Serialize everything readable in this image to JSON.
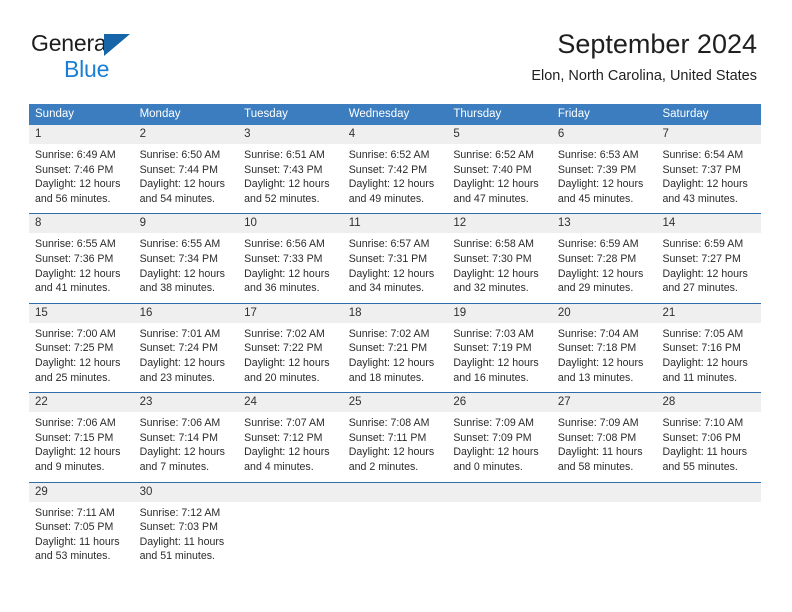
{
  "brand": {
    "line1": "General",
    "line2": "Blue",
    "triangle_color": "#1565a8",
    "blue_color": "#1a7fd4"
  },
  "header": {
    "title": "September 2024",
    "subtitle": "Elon, North Carolina, United States"
  },
  "theme": {
    "header_blue": "#3b7dbf",
    "row_divider_blue": "#2f6da8",
    "day_band_gray": "#efefef",
    "text": "#2b2b2b"
  },
  "weekdays": [
    "Sunday",
    "Monday",
    "Tuesday",
    "Wednesday",
    "Thursday",
    "Friday",
    "Saturday"
  ],
  "weeks": [
    [
      {
        "day": "1",
        "sunrise": "Sunrise: 6:49 AM",
        "sunset": "Sunset: 7:46 PM",
        "daylight1": "Daylight: 12 hours",
        "daylight2": "and 56 minutes."
      },
      {
        "day": "2",
        "sunrise": "Sunrise: 6:50 AM",
        "sunset": "Sunset: 7:44 PM",
        "daylight1": "Daylight: 12 hours",
        "daylight2": "and 54 minutes."
      },
      {
        "day": "3",
        "sunrise": "Sunrise: 6:51 AM",
        "sunset": "Sunset: 7:43 PM",
        "daylight1": "Daylight: 12 hours",
        "daylight2": "and 52 minutes."
      },
      {
        "day": "4",
        "sunrise": "Sunrise: 6:52 AM",
        "sunset": "Sunset: 7:42 PM",
        "daylight1": "Daylight: 12 hours",
        "daylight2": "and 49 minutes."
      },
      {
        "day": "5",
        "sunrise": "Sunrise: 6:52 AM",
        "sunset": "Sunset: 7:40 PM",
        "daylight1": "Daylight: 12 hours",
        "daylight2": "and 47 minutes."
      },
      {
        "day": "6",
        "sunrise": "Sunrise: 6:53 AM",
        "sunset": "Sunset: 7:39 PM",
        "daylight1": "Daylight: 12 hours",
        "daylight2": "and 45 minutes."
      },
      {
        "day": "7",
        "sunrise": "Sunrise: 6:54 AM",
        "sunset": "Sunset: 7:37 PM",
        "daylight1": "Daylight: 12 hours",
        "daylight2": "and 43 minutes."
      }
    ],
    [
      {
        "day": "8",
        "sunrise": "Sunrise: 6:55 AM",
        "sunset": "Sunset: 7:36 PM",
        "daylight1": "Daylight: 12 hours",
        "daylight2": "and 41 minutes."
      },
      {
        "day": "9",
        "sunrise": "Sunrise: 6:55 AM",
        "sunset": "Sunset: 7:34 PM",
        "daylight1": "Daylight: 12 hours",
        "daylight2": "and 38 minutes."
      },
      {
        "day": "10",
        "sunrise": "Sunrise: 6:56 AM",
        "sunset": "Sunset: 7:33 PM",
        "daylight1": "Daylight: 12 hours",
        "daylight2": "and 36 minutes."
      },
      {
        "day": "11",
        "sunrise": "Sunrise: 6:57 AM",
        "sunset": "Sunset: 7:31 PM",
        "daylight1": "Daylight: 12 hours",
        "daylight2": "and 34 minutes."
      },
      {
        "day": "12",
        "sunrise": "Sunrise: 6:58 AM",
        "sunset": "Sunset: 7:30 PM",
        "daylight1": "Daylight: 12 hours",
        "daylight2": "and 32 minutes."
      },
      {
        "day": "13",
        "sunrise": "Sunrise: 6:59 AM",
        "sunset": "Sunset: 7:28 PM",
        "daylight1": "Daylight: 12 hours",
        "daylight2": "and 29 minutes."
      },
      {
        "day": "14",
        "sunrise": "Sunrise: 6:59 AM",
        "sunset": "Sunset: 7:27 PM",
        "daylight1": "Daylight: 12 hours",
        "daylight2": "and 27 minutes."
      }
    ],
    [
      {
        "day": "15",
        "sunrise": "Sunrise: 7:00 AM",
        "sunset": "Sunset: 7:25 PM",
        "daylight1": "Daylight: 12 hours",
        "daylight2": "and 25 minutes."
      },
      {
        "day": "16",
        "sunrise": "Sunrise: 7:01 AM",
        "sunset": "Sunset: 7:24 PM",
        "daylight1": "Daylight: 12 hours",
        "daylight2": "and 23 minutes."
      },
      {
        "day": "17",
        "sunrise": "Sunrise: 7:02 AM",
        "sunset": "Sunset: 7:22 PM",
        "daylight1": "Daylight: 12 hours",
        "daylight2": "and 20 minutes."
      },
      {
        "day": "18",
        "sunrise": "Sunrise: 7:02 AM",
        "sunset": "Sunset: 7:21 PM",
        "daylight1": "Daylight: 12 hours",
        "daylight2": "and 18 minutes."
      },
      {
        "day": "19",
        "sunrise": "Sunrise: 7:03 AM",
        "sunset": "Sunset: 7:19 PM",
        "daylight1": "Daylight: 12 hours",
        "daylight2": "and 16 minutes."
      },
      {
        "day": "20",
        "sunrise": "Sunrise: 7:04 AM",
        "sunset": "Sunset: 7:18 PM",
        "daylight1": "Daylight: 12 hours",
        "daylight2": "and 13 minutes."
      },
      {
        "day": "21",
        "sunrise": "Sunrise: 7:05 AM",
        "sunset": "Sunset: 7:16 PM",
        "daylight1": "Daylight: 12 hours",
        "daylight2": "and 11 minutes."
      }
    ],
    [
      {
        "day": "22",
        "sunrise": "Sunrise: 7:06 AM",
        "sunset": "Sunset: 7:15 PM",
        "daylight1": "Daylight: 12 hours",
        "daylight2": "and 9 minutes."
      },
      {
        "day": "23",
        "sunrise": "Sunrise: 7:06 AM",
        "sunset": "Sunset: 7:14 PM",
        "daylight1": "Daylight: 12 hours",
        "daylight2": "and 7 minutes."
      },
      {
        "day": "24",
        "sunrise": "Sunrise: 7:07 AM",
        "sunset": "Sunset: 7:12 PM",
        "daylight1": "Daylight: 12 hours",
        "daylight2": "and 4 minutes."
      },
      {
        "day": "25",
        "sunrise": "Sunrise: 7:08 AM",
        "sunset": "Sunset: 7:11 PM",
        "daylight1": "Daylight: 12 hours",
        "daylight2": "and 2 minutes."
      },
      {
        "day": "26",
        "sunrise": "Sunrise: 7:09 AM",
        "sunset": "Sunset: 7:09 PM",
        "daylight1": "Daylight: 12 hours",
        "daylight2": "and 0 minutes."
      },
      {
        "day": "27",
        "sunrise": "Sunrise: 7:09 AM",
        "sunset": "Sunset: 7:08 PM",
        "daylight1": "Daylight: 11 hours",
        "daylight2": "and 58 minutes."
      },
      {
        "day": "28",
        "sunrise": "Sunrise: 7:10 AM",
        "sunset": "Sunset: 7:06 PM",
        "daylight1": "Daylight: 11 hours",
        "daylight2": "and 55 minutes."
      }
    ],
    [
      {
        "day": "29",
        "sunrise": "Sunrise: 7:11 AM",
        "sunset": "Sunset: 7:05 PM",
        "daylight1": "Daylight: 11 hours",
        "daylight2": "and 53 minutes."
      },
      {
        "day": "30",
        "sunrise": "Sunrise: 7:12 AM",
        "sunset": "Sunset: 7:03 PM",
        "daylight1": "Daylight: 11 hours",
        "daylight2": "and 51 minutes."
      },
      {
        "day": "",
        "sunrise": "",
        "sunset": "",
        "daylight1": "",
        "daylight2": ""
      },
      {
        "day": "",
        "sunrise": "",
        "sunset": "",
        "daylight1": "",
        "daylight2": ""
      },
      {
        "day": "",
        "sunrise": "",
        "sunset": "",
        "daylight1": "",
        "daylight2": ""
      },
      {
        "day": "",
        "sunrise": "",
        "sunset": "",
        "daylight1": "",
        "daylight2": ""
      },
      {
        "day": "",
        "sunrise": "",
        "sunset": "",
        "daylight1": "",
        "daylight2": ""
      }
    ]
  ]
}
